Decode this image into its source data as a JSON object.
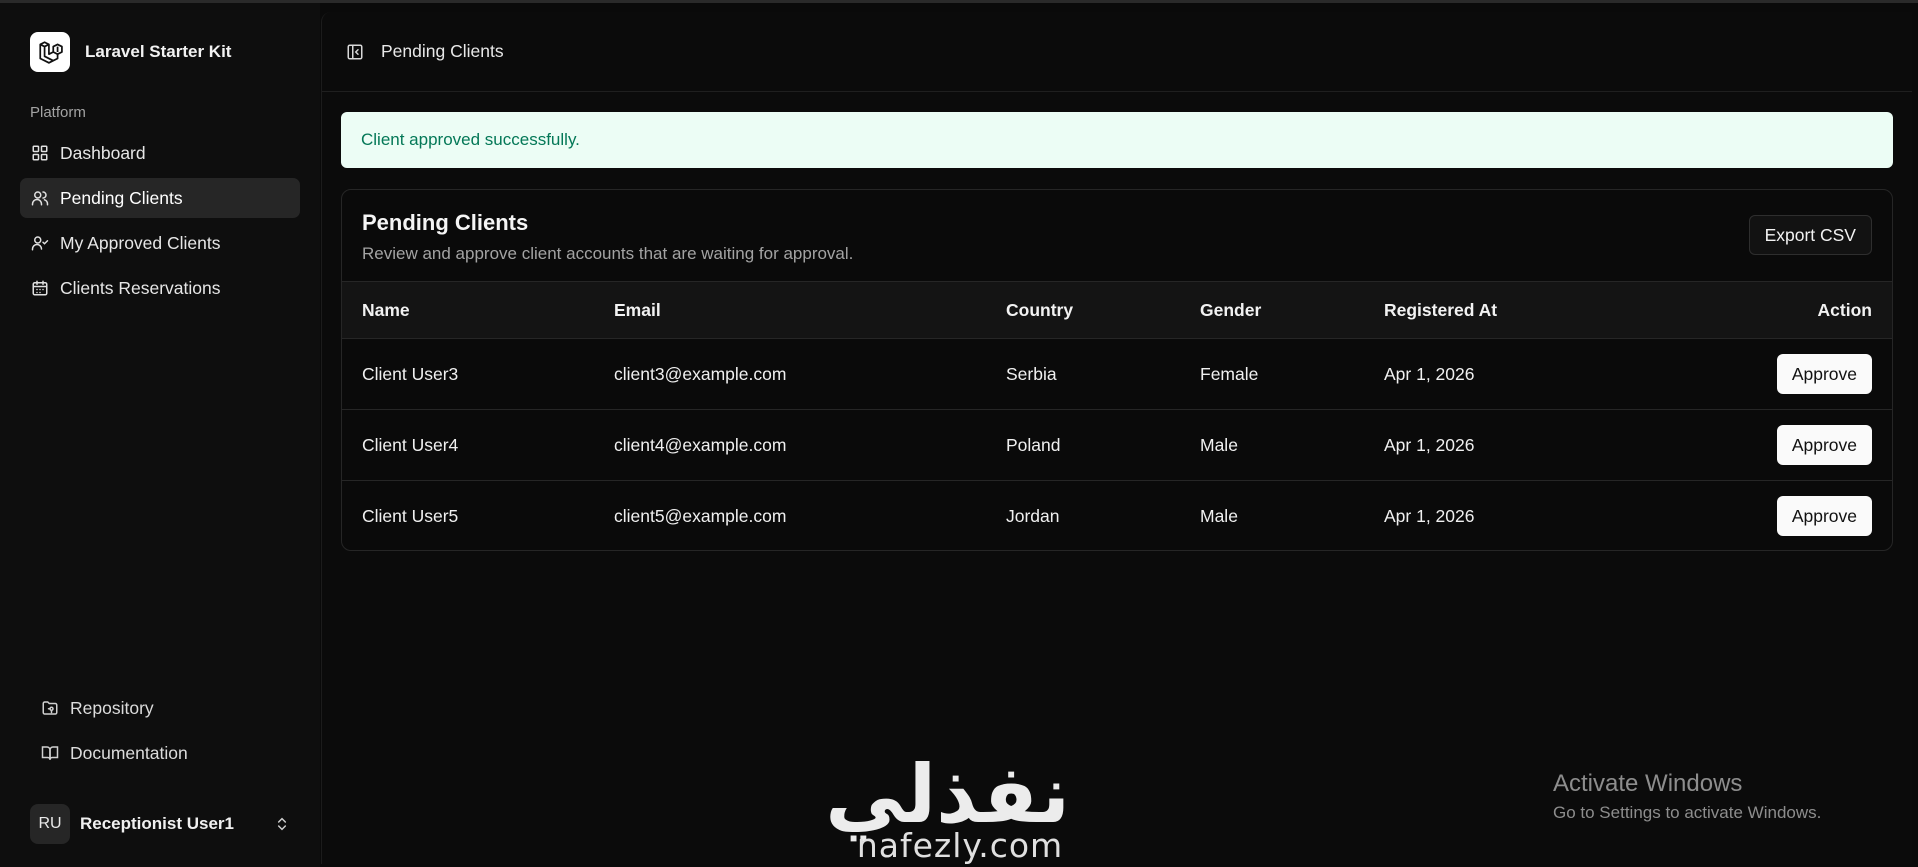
{
  "app": {
    "name": "Laravel Starter Kit"
  },
  "sidebar": {
    "section_label": "Platform",
    "items": [
      {
        "label": "Dashboard",
        "icon": "grid-icon",
        "active": false
      },
      {
        "label": "Pending Clients",
        "icon": "users-icon",
        "active": true
      },
      {
        "label": "My Approved Clients",
        "icon": "user-check-icon",
        "active": false
      },
      {
        "label": "Clients Reservations",
        "icon": "calendar-icon",
        "active": false
      }
    ],
    "footer_links": [
      {
        "label": "Repository",
        "icon": "folder-git-icon"
      },
      {
        "label": "Documentation",
        "icon": "book-open-icon"
      }
    ],
    "user": {
      "initials": "RU",
      "name": "Receptionist User1"
    }
  },
  "header": {
    "breadcrumb": "Pending Clients"
  },
  "alert": {
    "message": "Client approved successfully.",
    "color": "#047857",
    "background": "#ecfdf5"
  },
  "card": {
    "title": "Pending Clients",
    "description": "Review and approve client accounts that are waiting for approval.",
    "export_label": "Export CSV"
  },
  "table": {
    "columns": [
      "Name",
      "Email",
      "Country",
      "Gender",
      "Registered At",
      "Action"
    ],
    "rows": [
      {
        "name": "Client User3",
        "email": "client3@example.com",
        "country": "Serbia",
        "gender": "Female",
        "registered_at": "Apr 1, 2026",
        "action": "Approve"
      },
      {
        "name": "Client User4",
        "email": "client4@example.com",
        "country": "Poland",
        "gender": "Male",
        "registered_at": "Apr 1, 2026",
        "action": "Approve"
      },
      {
        "name": "Client User5",
        "email": "client5@example.com",
        "country": "Jordan",
        "gender": "Male",
        "registered_at": "Apr 1, 2026",
        "action": "Approve"
      }
    ]
  },
  "watermark": {
    "arabic": "نفذلي",
    "latin": "nafezly.com"
  },
  "windows_activation": {
    "title": "Activate Windows",
    "subtitle": "Go to Settings to activate Windows."
  }
}
